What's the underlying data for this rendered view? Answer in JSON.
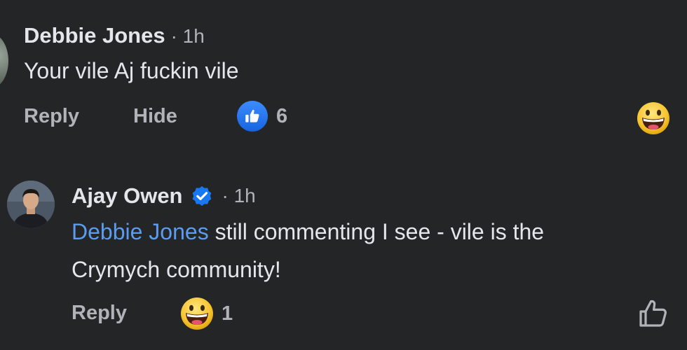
{
  "comments": [
    {
      "author": "Debbie Jones",
      "time": "· 1h",
      "text": "Your vile Aj  fuckin vile",
      "actions": {
        "reply": "Reply",
        "hide": "Hide"
      },
      "like_count": "6",
      "reaction_icon": "grinning-face-icon"
    },
    {
      "author": "Ajay Owen",
      "verified_icon": "verified-badge-icon",
      "time": "· 1h",
      "mention": "Debbie Jones",
      "text_line1": " still commenting I see - vile is the",
      "text_line2": "Crymych community!",
      "actions": {
        "reply": "Reply"
      },
      "reaction_count": "1",
      "reaction_icon": "grinning-face-icon",
      "like_icon": "thumbs-up-outline-icon"
    }
  ],
  "colors": {
    "background": "#242526",
    "primary_text": "#e4e6eb",
    "secondary_text": "#b0b3b8",
    "mention": "#5b9cf0",
    "like_blue": "#1877f2"
  }
}
